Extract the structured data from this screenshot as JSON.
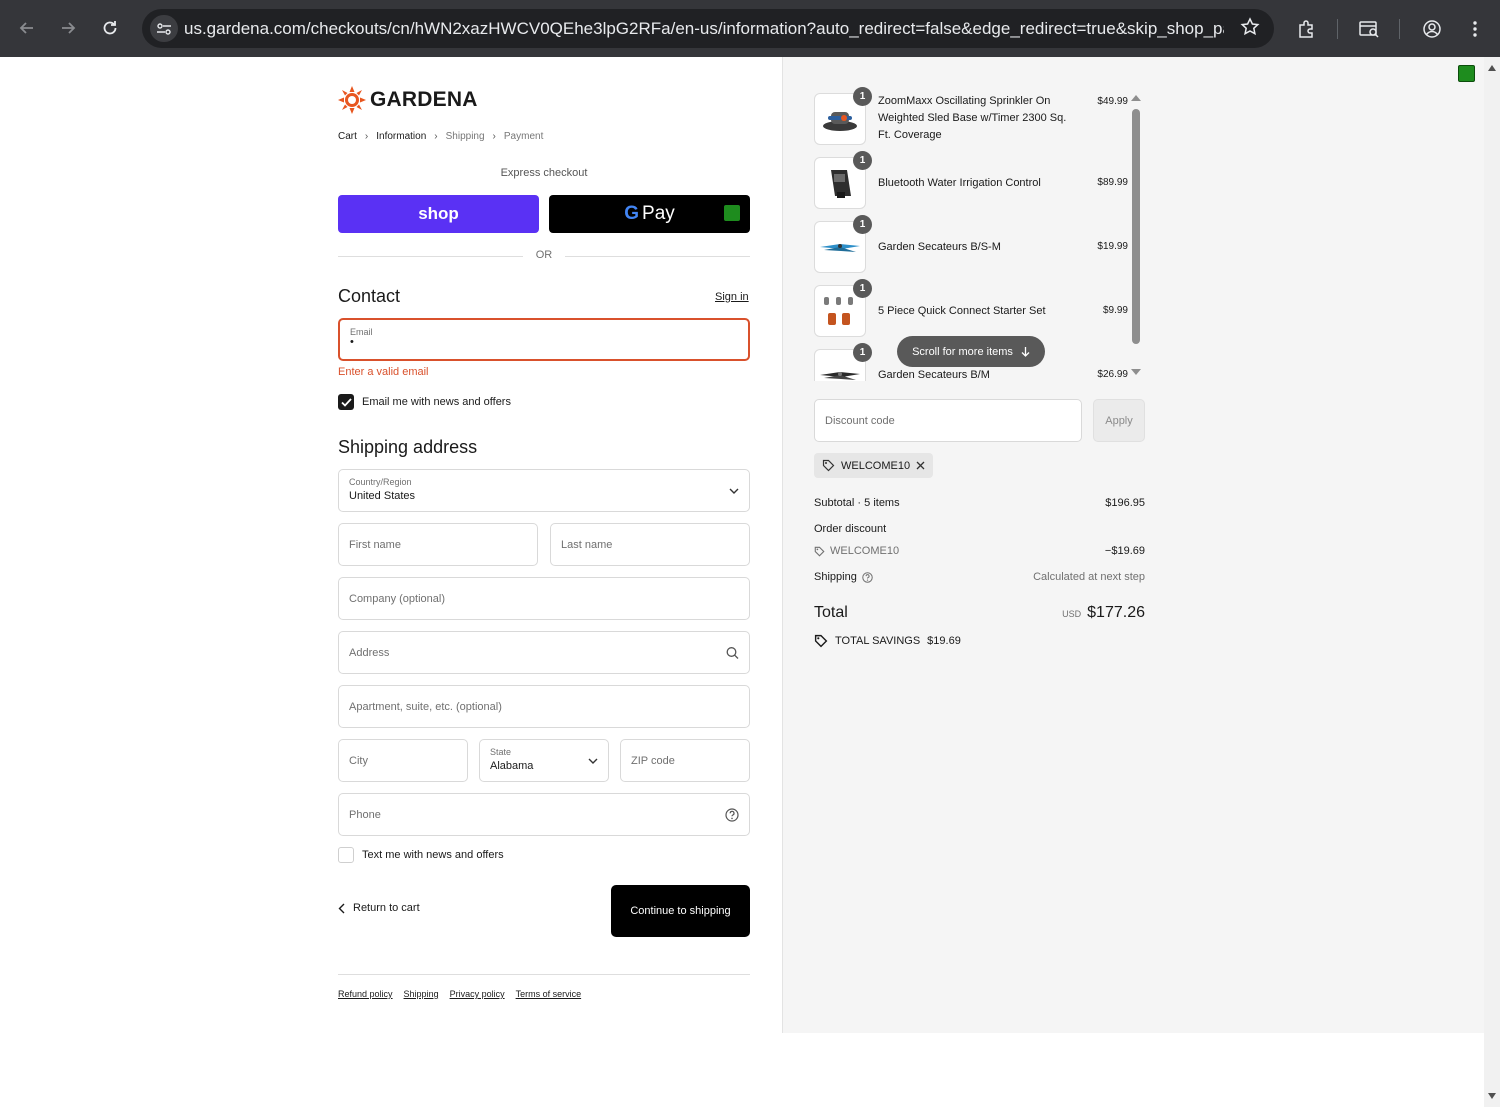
{
  "browser": {
    "url": "us.gardena.com/checkouts/cn/hWN2xazHWCV0QEhe3lpG2RFa/en-us/information?auto_redirect=false&edge_redirect=true&skip_shop_pay=t..."
  },
  "brand": {
    "name": "GARDENA",
    "accent": "#e8561f"
  },
  "breadcrumb": [
    "Cart",
    "Information",
    "Shipping",
    "Payment"
  ],
  "express": {
    "label": "Express checkout",
    "shop_label": "shop",
    "gpay_g": "G",
    "gpay_label": "Pay",
    "or_label": "OR"
  },
  "contact": {
    "title": "Contact",
    "signin_label": "Sign in",
    "email_label": "Email",
    "email_value": "•",
    "error": "Enter a valid email",
    "news_checkbox": "Email me with news and offers",
    "news_checked": true
  },
  "shipping": {
    "title": "Shipping address",
    "country_label": "Country/Region",
    "country_value": "United States",
    "first_name_ph": "First name",
    "last_name_ph": "Last name",
    "company_ph": "Company (optional)",
    "address_ph": "Address",
    "apartment_ph": "Apartment, suite, etc. (optional)",
    "city_ph": "City",
    "state_label": "State",
    "state_value": "Alabama",
    "zip_ph": "ZIP code",
    "phone_ph": "Phone",
    "sms_checkbox": "Text me with news and offers",
    "sms_checked": false
  },
  "actions": {
    "return_label": "Return to cart",
    "continue_label": "Continue to shipping"
  },
  "footer_links": [
    "Refund policy",
    "Shipping",
    "Privacy policy",
    "Terms of service"
  ],
  "order": {
    "items": [
      {
        "qty": "1",
        "name": "ZoomMaxx Oscillating Sprinkler On Weighted Sled Base w/Timer 2300 Sq. Ft. Coverage",
        "price": "$49.99",
        "icon": "sprinkler-icon"
      },
      {
        "qty": "1",
        "name": "Bluetooth Water Irrigation Control",
        "price": "$89.99",
        "icon": "irrigation-controller-icon"
      },
      {
        "qty": "1",
        "name": "Garden Secateurs B/S-M",
        "price": "$19.99",
        "icon": "secateurs-icon"
      },
      {
        "qty": "1",
        "name": "5 Piece Quick Connect Starter Set",
        "price": "$9.99",
        "icon": "connector-set-icon"
      },
      {
        "qty": "1",
        "name": "Garden Secateurs B/M",
        "price": "$26.99",
        "icon": "secateurs-icon"
      }
    ],
    "scroll_more_label": "Scroll for more items",
    "discount_ph": "Discount code",
    "apply_label": "Apply",
    "applied_code": "WELCOME10",
    "subtotal_label": "Subtotal · 5 items",
    "subtotal_value": "$196.95",
    "order_discount_label": "Order discount",
    "discount_code_label": "WELCOME10",
    "discount_value": "−$19.69",
    "shipping_label": "Shipping",
    "shipping_value": "Calculated at next step",
    "total_label": "Total",
    "total_currency": "USD",
    "total_value": "$177.26",
    "savings_label": "TOTAL SAVINGS",
    "savings_value": "$19.69"
  },
  "colors": {
    "shop_pay": "#5a31f4",
    "error": "#d9512c",
    "summary_bg": "#f5f5f5"
  }
}
